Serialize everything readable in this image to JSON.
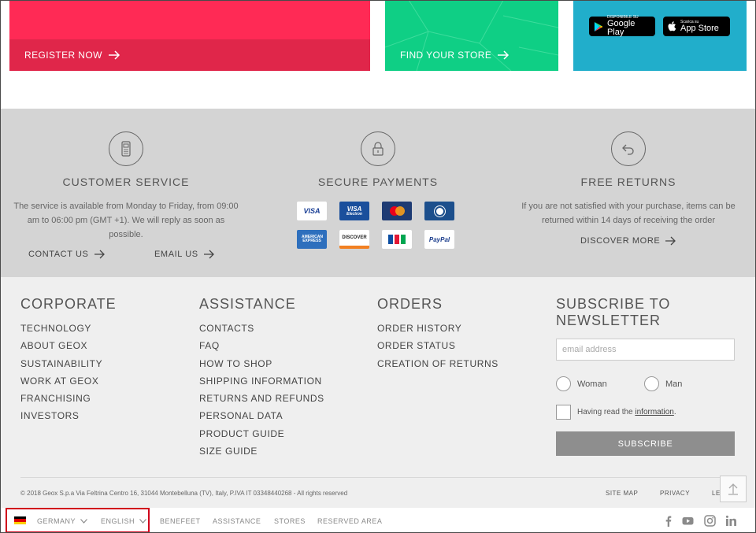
{
  "promo": {
    "register_label": "REGISTER NOW",
    "store_label": "FIND YOUR STORE",
    "google_play": {
      "small": "DISPONIBILE SU",
      "big": "Google Play"
    },
    "app_store": {
      "small": "Scarica su",
      "big": "App Store"
    },
    "colors": {
      "register": "#ff2a55",
      "store": "#0fcf85",
      "app": "#21aecb"
    }
  },
  "services": {
    "customer": {
      "title": "CUSTOMER SERVICE",
      "text": "The service is available from Monday to Friday, from 09:00 am to 06:00 pm (GMT +1). We will reply as soon as possible.",
      "contact_label": "CONTACT US",
      "email_label": "EMAIL US",
      "icon": "phone-icon"
    },
    "payments": {
      "title": "SECURE PAYMENTS",
      "icon": "lock-icon",
      "cards": {
        "visa": "VISA",
        "electron_top": "VISA",
        "electron_bottom": "Electron",
        "amex": "AMERICAN EXPRESS",
        "discover": "DISCOVER",
        "paypal": "PayPal"
      }
    },
    "returns": {
      "title": "FREE RETURNS",
      "text": "If you are not satisfied with your purchase, items can be returned within 14 days of receiving the order",
      "discover_label": "DISCOVER MORE",
      "icon": "return-arrow-icon"
    }
  },
  "corporate": {
    "title": "CORPORATE",
    "items": [
      "TECHNOLOGY",
      "ABOUT GEOX",
      "SUSTAINABILITY",
      "WORK AT GEOX",
      "FRANCHISING",
      "INVESTORS"
    ]
  },
  "assistance": {
    "title": "ASSISTANCE",
    "items": [
      "CONTACTS",
      "FAQ",
      "HOW TO SHOP",
      "SHIPPING INFORMATION",
      "RETURNS AND REFUNDS",
      "PERSONAL DATA",
      "PRODUCT GUIDE",
      "SIZE GUIDE"
    ]
  },
  "orders": {
    "title": "ORDERS",
    "items": [
      "ORDER HISTORY",
      "ORDER STATUS",
      "CREATION OF RETURNS"
    ]
  },
  "newsletter": {
    "title": "SUBSCRIBE TO NEWSLETTER",
    "email_placeholder": "email address",
    "email_value": "",
    "woman_label": "Woman",
    "man_label": "Man",
    "consent_prefix": "Having read the ",
    "consent_link": "information",
    "consent_suffix": ".",
    "subscribe_label": "SUBSCRIBE"
  },
  "legal": {
    "copyright": "© 2018 Geox S.p.a Via Feltrina Centro 16, 31044 Montebelluna (TV), Italy, P.IVA IT 03348440268 - All rights reserved",
    "site_map": "SITE MAP",
    "privacy": "PRIVACY",
    "legal_partial": "LE"
  },
  "bottom": {
    "country": "GERMANY",
    "language": "ENGLISH",
    "links": [
      "BENEFEET",
      "ASSISTANCE",
      "STORES",
      "RESERVED AREA"
    ],
    "highlight_color": "#d0021b",
    "socials": [
      "facebook-icon",
      "youtube-icon",
      "instagram-icon",
      "linkedin-icon"
    ]
  }
}
